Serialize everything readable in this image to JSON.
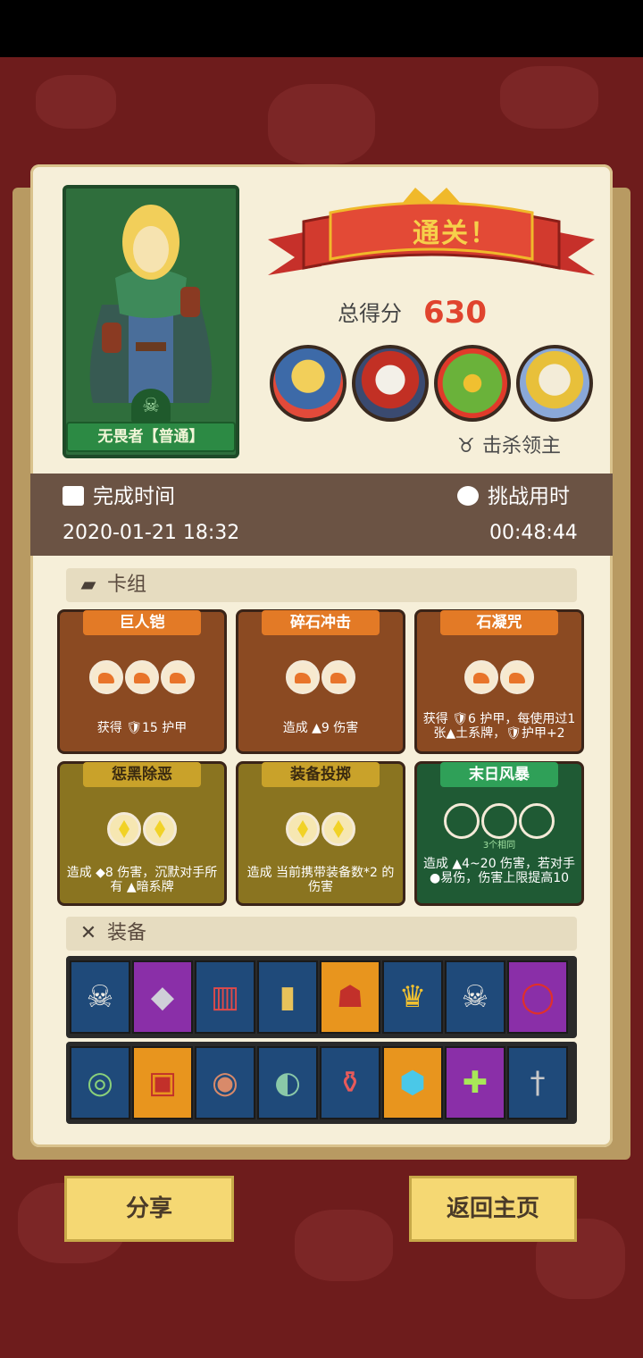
{
  "hero": {
    "name": "无畏者【普通】"
  },
  "result": {
    "banner": "通关！",
    "score_label": "总得分",
    "score_value": "630"
  },
  "bosses": [
    "boss-wizard",
    "boss-skull-king",
    "boss-green-demon",
    "boss-bone-dragon"
  ],
  "kill_lord_label": "击杀领主",
  "time": {
    "complete_label": "完成时间",
    "complete_value": "2020-01-21 18:32",
    "duration_label": "挑战用时",
    "duration_value": "00:48:44"
  },
  "deck": {
    "title": "卡组",
    "cards": [
      {
        "name": "巨人铠",
        "color": "orange",
        "orbs": 3,
        "text": "获得 🛡15 护甲"
      },
      {
        "name": "碎石冲击",
        "color": "orange",
        "orbs": 2,
        "text": "造成 ▲9 伤害"
      },
      {
        "name": "石凝咒",
        "color": "orange",
        "orbs": 2,
        "text": "获得 🛡6 护甲，每使用过1张▲土系牌，🛡护甲+2"
      },
      {
        "name": "惩黑除恶",
        "color": "yellow",
        "orbs": 2,
        "text": "造成 ◆8 伤害，沉默对手所有 ▲暗系牌"
      },
      {
        "name": "装备投掷",
        "color": "yellow",
        "orbs": 2,
        "text": "造成 当前携带装备数*2 的伤害"
      },
      {
        "name": "末日风暴",
        "color": "green",
        "orbs": 3,
        "sub": "3个相同",
        "text": "造成 ▲4~20 伤害，若对手 ●易伤，伤害上限提高10"
      }
    ]
  },
  "equipment": {
    "title": "装备",
    "row1": [
      {
        "icon": "skull-icon",
        "bg": "#1f4a7a",
        "glyph": "💀"
      },
      {
        "icon": "gem-icon",
        "bg": "#8a2fa8",
        "glyph": "◆"
      },
      {
        "icon": "red-cloth-icon",
        "bg": "#1f4a7a",
        "glyph": "▥"
      },
      {
        "icon": "tag-icon",
        "bg": "#1f4a7a",
        "glyph": "▮"
      },
      {
        "icon": "demon-mask-icon",
        "bg": "#e8951e",
        "glyph": "☗"
      },
      {
        "icon": "crown-helmet-icon",
        "bg": "#1f4a7a",
        "glyph": "♛"
      },
      {
        "icon": "skull-spear-icon",
        "bg": "#1f4a7a",
        "glyph": "☠"
      },
      {
        "icon": "red-ring-icon",
        "bg": "#8a2fa8",
        "glyph": "◯"
      }
    ],
    "row2": [
      {
        "icon": "green-ring-icon",
        "bg": "#1f4a7a",
        "glyph": "◎"
      },
      {
        "icon": "red-bracer-icon",
        "bg": "#e8951e",
        "glyph": "▣"
      },
      {
        "icon": "shield-disc-icon",
        "bg": "#1f4a7a",
        "glyph": "◉"
      },
      {
        "icon": "eye-ring-icon",
        "bg": "#1f4a7a",
        "glyph": "◐"
      },
      {
        "icon": "potion-jar-icon",
        "bg": "#1f4a7a",
        "glyph": "⚱"
      },
      {
        "icon": "crystal-skull-icon",
        "bg": "#e8951e",
        "glyph": "⬢"
      },
      {
        "icon": "holy-ring-icon",
        "bg": "#8a2fa8",
        "glyph": "✚"
      },
      {
        "icon": "dagger-icon",
        "bg": "#1f4a7a",
        "glyph": "†"
      }
    ]
  },
  "buttons": {
    "share": "分享",
    "home": "返回主页"
  }
}
